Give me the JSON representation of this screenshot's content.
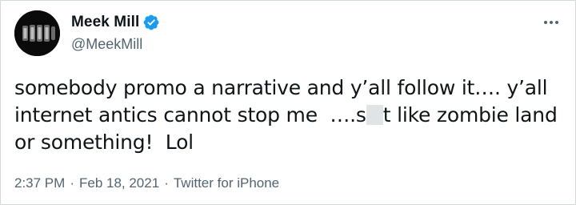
{
  "tweet": {
    "author": {
      "display_name": "Meek Mill",
      "handle": "@MeekMill",
      "verified": true,
      "verified_color": "#1d9bf0",
      "avatar_icon": "avatar-image"
    },
    "more_icon": "more-horizontal-icon",
    "text": {
      "line1": "somebody promo a narrative and y’all follow it…. y’all",
      "line2_before": "internet antics cannot stop me  ….s",
      "line2_after": "t like zombie land",
      "line3": "or something!  Lol"
    },
    "meta": {
      "time": "2:37 PM",
      "separator1": "·",
      "date": "Feb 18, 2021",
      "separator2": "·",
      "source": "Twitter for iPhone"
    }
  }
}
